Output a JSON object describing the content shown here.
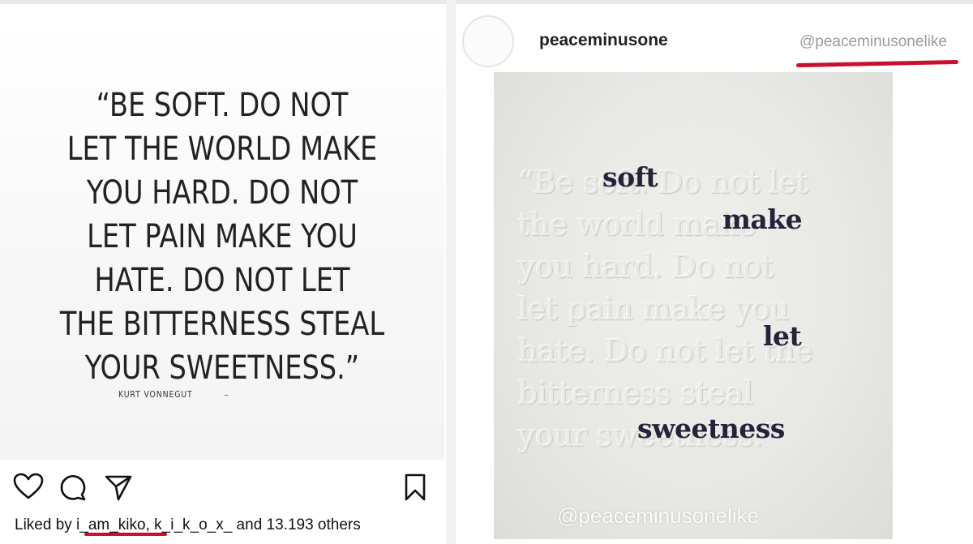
{
  "left_post": {
    "quote": "“BE SOFT. DO NOT\nLET THE WORLD MAKE\nYOU HARD. DO NOT\nLET PAIN MAKE YOU\nHATE. DO NOT LET\nTHE BITTERNESS STEAL\nYOUR SWEETNESS.”",
    "author": "KURT VONNEGUT",
    "icons": [
      "heart-icon",
      "comment-icon",
      "share-icon",
      "bookmark-icon"
    ],
    "likes": {
      "prefix": "Liked by ",
      "user1": "i_am_kiko",
      "separator": ", ",
      "user2": "k_i_k_o_x_",
      "suffix": " and 13.193 others"
    }
  },
  "right_post": {
    "username": "peaceminusone",
    "handle": "@peaceminusonelike",
    "embossed_text": "“Be soft. Do not let\nthe world make\nyou hard. Do not\nlet pain make you\nhate. Do not let the\nbitterness steal\nyour sweetness.”",
    "ink_words": [
      "soft",
      "make",
      "let",
      "sweetness"
    ],
    "watermark": "@peaceminusonelike"
  },
  "colors": {
    "annotation_red": "#c8102e",
    "ink": "#23233a",
    "handle_gray": "#9a9a9a"
  }
}
